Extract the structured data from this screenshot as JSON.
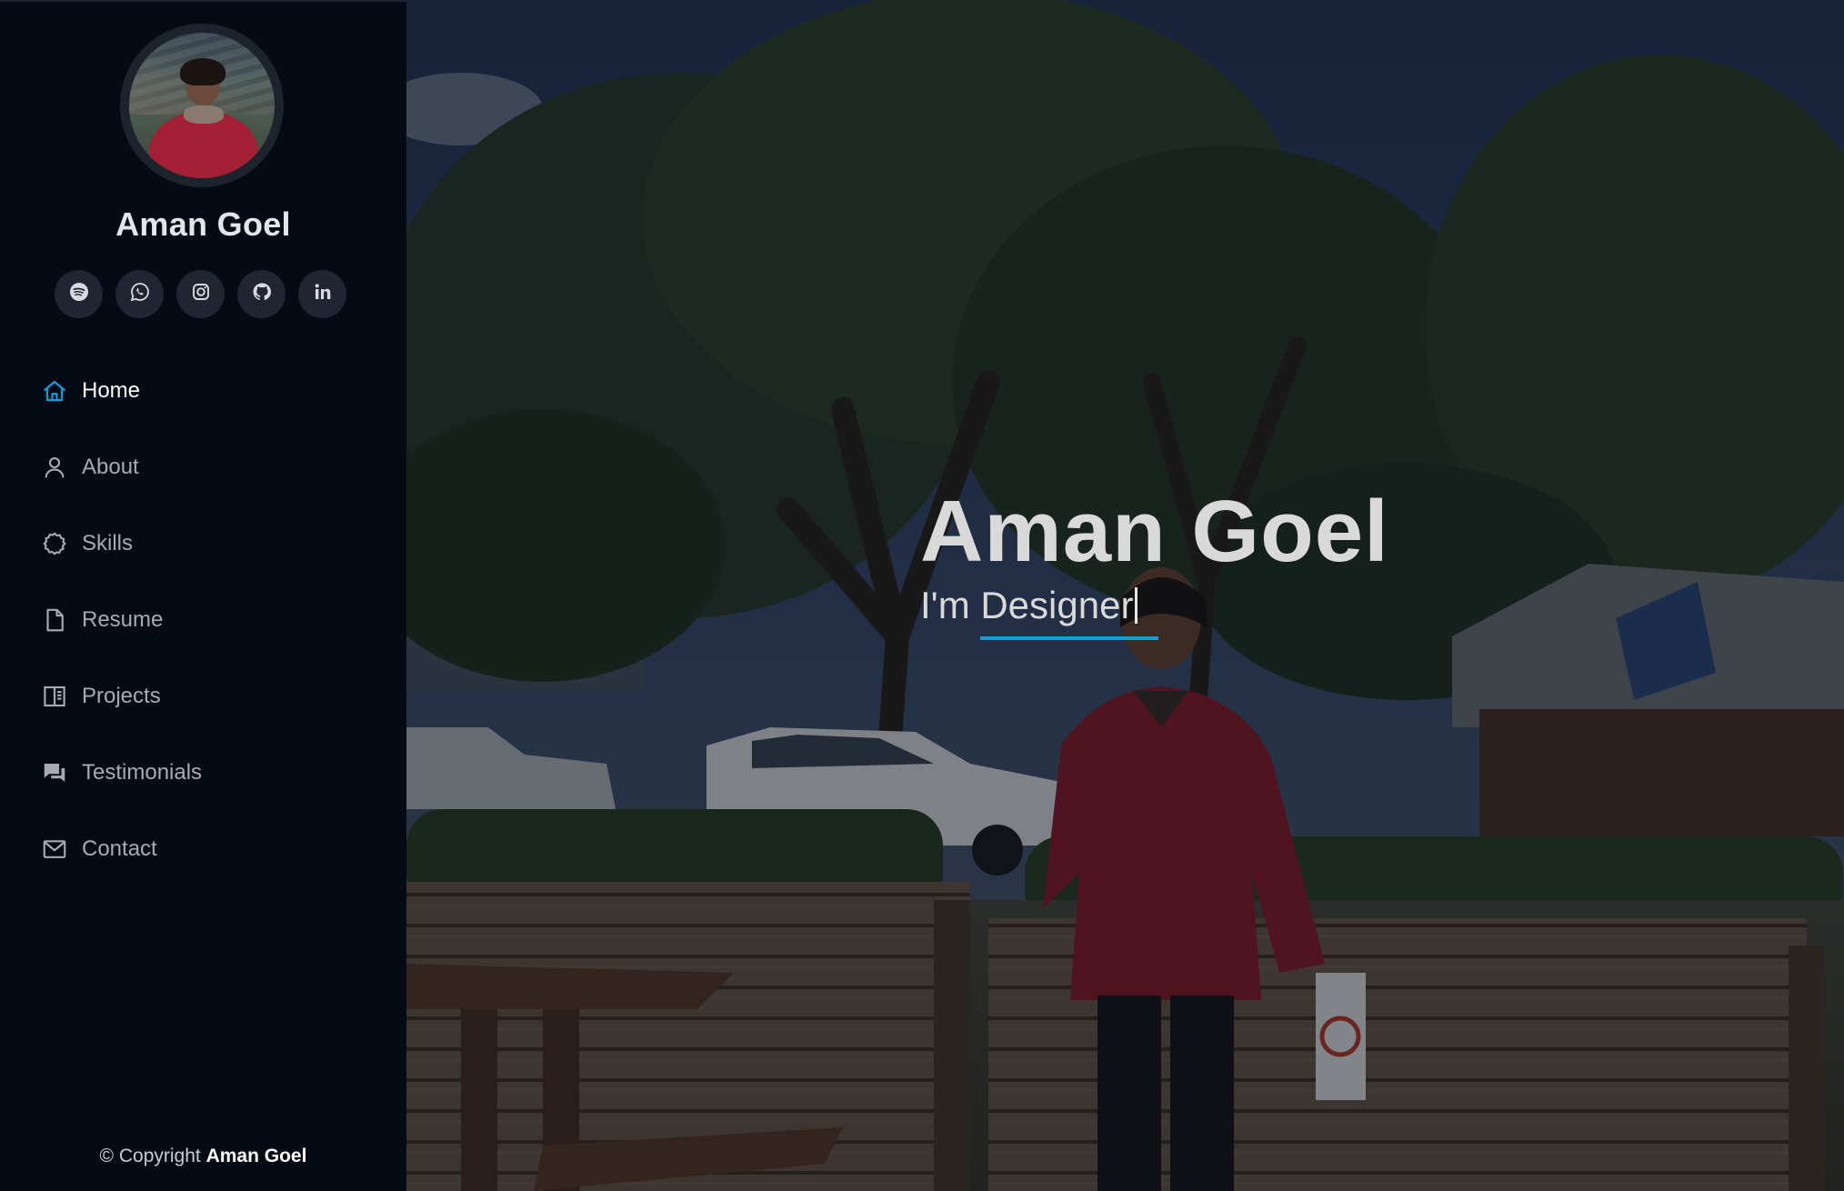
{
  "profile": {
    "name": "Aman Goel",
    "avatar_alt": "Aman Goel"
  },
  "socials": [
    {
      "name": "spotify",
      "icon": "spotify-icon"
    },
    {
      "name": "whatsapp",
      "icon": "whatsapp-icon"
    },
    {
      "name": "instagram",
      "icon": "instagram-icon"
    },
    {
      "name": "github",
      "icon": "github-icon"
    },
    {
      "name": "linkedin",
      "icon": "linkedin-icon"
    }
  ],
  "nav": {
    "items": [
      {
        "label": "Home",
        "icon": "home-icon",
        "active": true
      },
      {
        "label": "About",
        "icon": "user-icon",
        "active": false
      },
      {
        "label": "Skills",
        "icon": "gear-icon",
        "active": false
      },
      {
        "label": "Resume",
        "icon": "file-icon",
        "active": false
      },
      {
        "label": "Projects",
        "icon": "book-icon",
        "active": false
      },
      {
        "label": "Testimonials",
        "icon": "chat-icon",
        "active": false
      },
      {
        "label": "Contact",
        "icon": "envelope-icon",
        "active": false
      }
    ]
  },
  "footer": {
    "copyright_prefix": "© Copyright",
    "copyright_name": "Aman Goel"
  },
  "hero": {
    "title": "Aman Goel",
    "subtitle": "I'm Designer"
  },
  "colors": {
    "sidebar_bg": "#040b14",
    "accent": "#149ddd",
    "social_bg": "#212431",
    "nav_text": "#a8a9b4"
  }
}
